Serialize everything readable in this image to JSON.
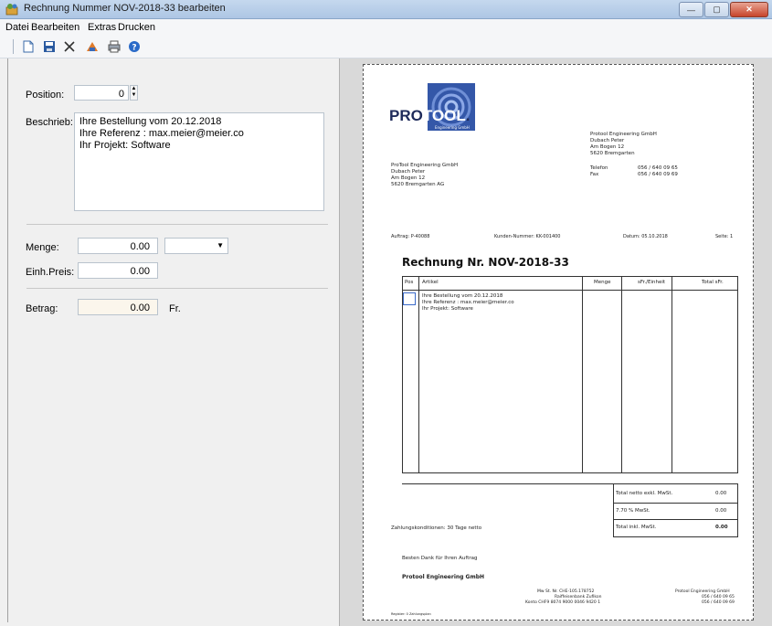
{
  "window": {
    "title": "Rechnung Nummer NOV-2018-33 bearbeiten"
  },
  "menu": {
    "datei": "Datei",
    "bearbeiten": "Bearbeiten",
    "extras": "Extras",
    "drucken": "Drucken"
  },
  "toolbar": {
    "icons": [
      "new-document-icon",
      "save-icon",
      "delete-icon",
      "article-icon",
      "print-icon",
      "help-icon"
    ]
  },
  "form": {
    "position_label": "Position:",
    "position_value": "0",
    "beschrieb_label": "Beschrieb:",
    "beschrieb_line1": "Ihre Bestellung vom 20.12.2018",
    "beschrieb_line2": "Ihre Referenz : max.meier@meier.co",
    "beschrieb_line3": "Ihr Projekt: Software",
    "menge_label": "Menge:",
    "menge_value": "0.00",
    "unit_value": "",
    "preis_label": "Einh.Preis:",
    "preis_value": "0.00",
    "betrag_label": "Betrag:",
    "betrag_value": "0.00",
    "currency": "Fr."
  },
  "invoice": {
    "logo_text_dark": "PRO",
    "logo_text_blue": "TOOL",
    "logo_sub": "Engineering GmbH",
    "sender_lines": [
      "Protool Engineering GmbH",
      "Dubach Peter",
      "Am Bogen 12",
      "5620 Bremgarten"
    ],
    "telefon_label": "Telefon",
    "telefon_value": "056 / 640 09 65",
    "fax_label": "Fax",
    "fax_value": "056 / 640 09 69",
    "recipient_lines": [
      "ProTool Engineering GmbH",
      "Dubach Peter",
      "Am Bogen 12",
      "5620 Bremgarten AG"
    ],
    "auftrag": "Auftrag: P-40088",
    "kunden_nr": "Kunden-Nummer: KK-001400",
    "datum": "Datum: 05.10.2018",
    "seite": "Seite: 1",
    "title": "Rechnung Nr. NOV-2018-33",
    "col_pos": "Pos",
    "col_artikel": "Artikel",
    "col_menge": "Menge",
    "col_einheit": "sFr./Einheit",
    "col_total": "Total sFr.",
    "item_line1": "Ihre Bestellung vom 20.12.2018",
    "item_line2": "Ihre Referenz : max.meier@meier.co",
    "item_line3": "Ihr Projekt: Software",
    "netto_label": "Total netto exkl. MwSt.",
    "netto_value": "0.00",
    "mwst_label": "7.70 % MwSt.",
    "mwst_value": "0.00",
    "inkl_label": "Total inkl. MwSt.",
    "inkl_value": "0.00",
    "zahlung": "Zahlungskonditionen: 30 Tage netto",
    "dank": "Besten Dank für Ihren Auftrag",
    "firma": "Protool Engineering GmbH",
    "footer_mid1": "Mw St. Nr. CHE-105.178752",
    "footer_mid2": "Raiffeisenbank Zufikon",
    "footer_mid3": "Konto CHF9 8074 9000 0046 9420 1",
    "footer_right1": "Protool Engineering GmbH",
    "footer_right2": "056 / 640 09 65",
    "footer_right3": "056 / 640 09 69",
    "footer_left": "Register: 0 Zahlungsplan"
  }
}
